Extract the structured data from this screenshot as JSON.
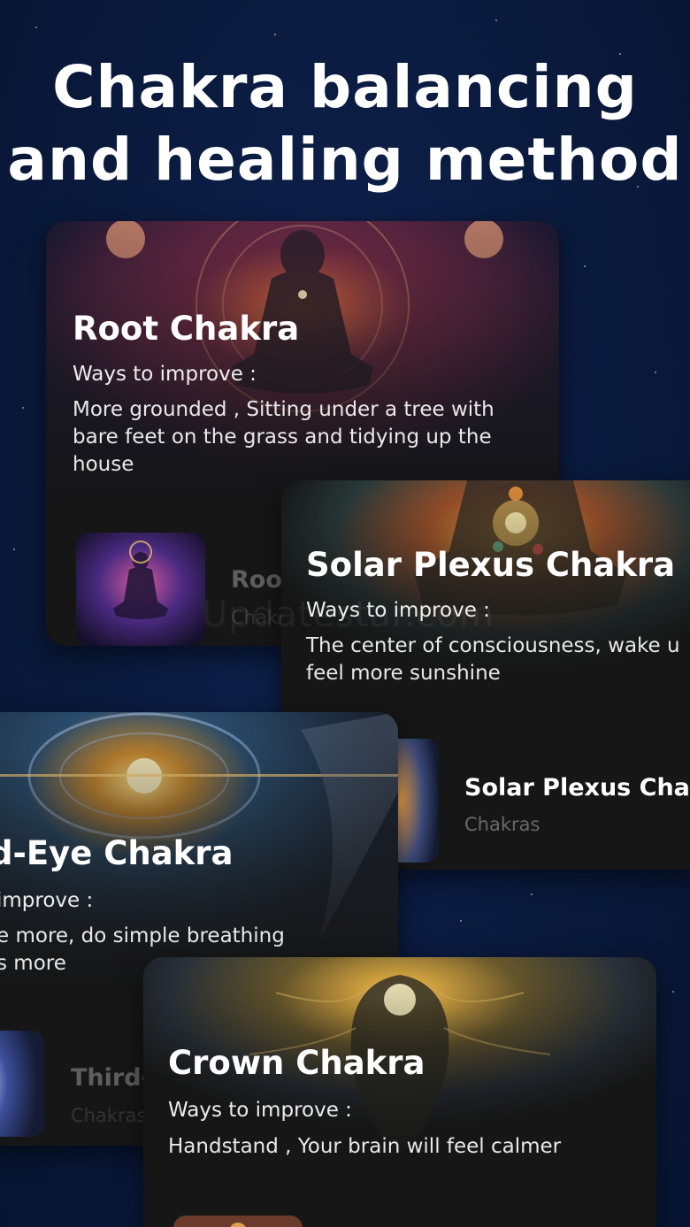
{
  "headline": {
    "line1": "Chakra balancing",
    "line2": "and healing method"
  },
  "cards": [
    {
      "title": "Root Chakra",
      "ways_label": "Ways to improve :",
      "description": "More grounded , Sitting under a tree with bare feet on the grass and tidying up the house",
      "list_title": "Root",
      "list_subtitle": "Chakras"
    },
    {
      "title": "Solar Plexus Chakra",
      "ways_label": "Ways to improve :",
      "description": "The center of consciousness, wake u feel more sunshine",
      "list_title": "Solar Plexus Chakr",
      "list_subtitle": "Chakras"
    },
    {
      "title": "d-Eye Chakra",
      "ways_label": "improve :",
      "description_line1": "e more, do simple breathing",
      "description_line2": "s more",
      "list_title": "Third-",
      "list_subtitle": "Chakras"
    },
    {
      "title": "Crown Chakra",
      "ways_label": "Ways to improve :",
      "description": "Handstand , Your brain will feel calmer"
    }
  ],
  "watermark": "Updatestar.com",
  "colors": {
    "background": "#0a1a3d",
    "card": "#161616",
    "text": "#ffffff",
    "muted_text": "#5a5a5a"
  }
}
